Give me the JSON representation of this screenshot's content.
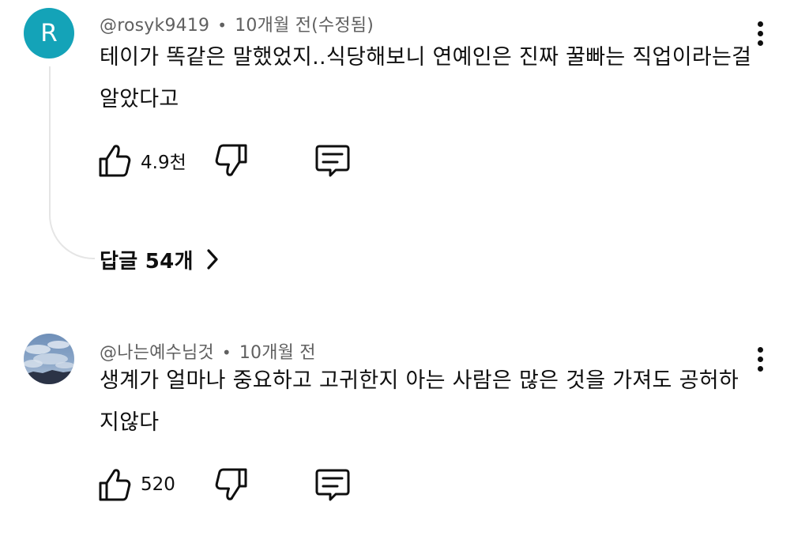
{
  "comments": [
    {
      "author": "@rosyk9419",
      "time": "10개월 전(수정됨)",
      "avatar_letter": "R",
      "avatar_color": "#14a3b8",
      "text": "테이가 똑같은 말했었지..식당해보니 연예인은 진짜 꿀빠는 직업이라는걸 알았다고",
      "likes": "4.9천",
      "replies_label": "답글 54개"
    },
    {
      "author": "@나는예수님것",
      "time": "10개월 전",
      "avatar_image": "sky-clouds-photo",
      "text": "생계가 얼마나 중요하고 고귀한지 아는 사람은 많은 것을 가져도 공허하지않다",
      "likes": "520"
    }
  ],
  "separator": "•",
  "icons": {
    "like": "thumbs-up-icon",
    "dislike": "thumbs-down-icon",
    "reply": "comment-icon",
    "menu": "more-vert-icon",
    "replies_toggle": "chevron-right-icon"
  },
  "colors": {
    "text": "#0f0f0f",
    "meta": "#606060",
    "thread_line": "#e5e5e5"
  }
}
